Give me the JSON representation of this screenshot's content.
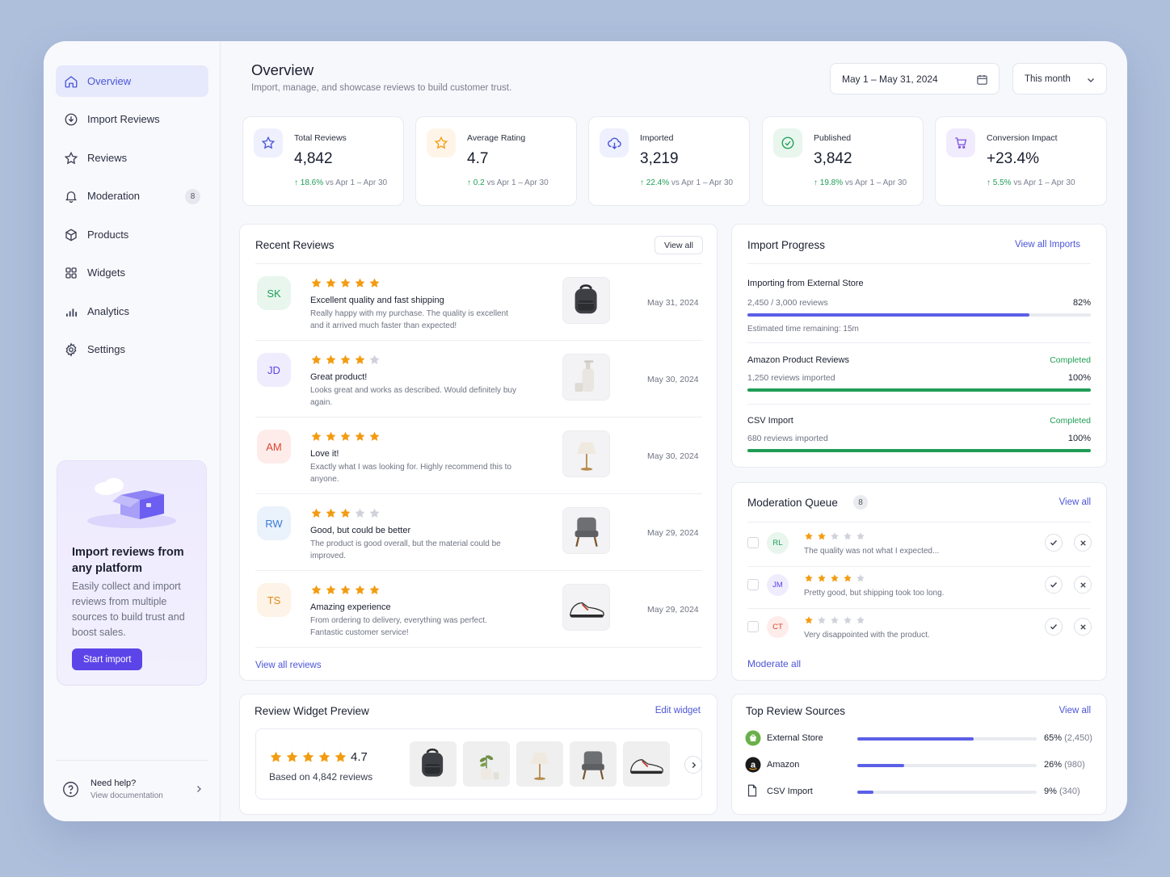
{
  "sidebar": {
    "items": [
      {
        "label": "Overview",
        "icon": "home-icon"
      },
      {
        "label": "Import Reviews",
        "icon": "import-icon"
      },
      {
        "label": "Reviews",
        "icon": "star-icon"
      },
      {
        "label": "Moderation",
        "icon": "bell-icon",
        "badge": "8"
      },
      {
        "label": "Products",
        "icon": "box-icon"
      },
      {
        "label": "Widgets",
        "icon": "grid-icon"
      },
      {
        "label": "Analytics",
        "icon": "chart-icon"
      },
      {
        "label": "Settings",
        "icon": "gear-icon"
      }
    ],
    "promo": {
      "title": "Import reviews from any platform",
      "text": "Easily collect and import reviews from multiple sources to build trust and boost sales.",
      "button": "Start import"
    },
    "help": {
      "title": "Need help?",
      "subtitle": "View documentation"
    }
  },
  "header": {
    "title": "Overview",
    "subtitle": "Import, manage, and showcase reviews to build customer trust.",
    "date_range": "May 1 – May 31, 2024",
    "period": "This month"
  },
  "stats": [
    {
      "label": "Total Reviews",
      "value": "4,842",
      "change": "18.6%",
      "compare": "vs Apr 1 – Apr 30",
      "icon": "star-icon",
      "accent": "#4b55d8",
      "bg": "#eef0fd"
    },
    {
      "label": "Average Rating",
      "value": "4.7",
      "change": "0.2",
      "compare": "vs Apr 1 – Apr 30",
      "icon": "star-icon",
      "accent": "#f39c12",
      "bg": "#fef5e8"
    },
    {
      "label": "Imported",
      "value": "3,219",
      "change": "22.4%",
      "compare": "vs Apr 1 – Apr 30",
      "icon": "cloud-download-icon",
      "accent": "#4b55d8",
      "bg": "#eef0fd"
    },
    {
      "label": "Published",
      "value": "3,842",
      "change": "19.8%",
      "compare": "vs Apr 1 – Apr 30",
      "icon": "check-circle-icon",
      "accent": "#1f9d55",
      "bg": "#e8f6ee"
    },
    {
      "label": "Conversion Impact",
      "value": "+23.4%",
      "change": "5.5%",
      "compare": "vs Apr 1 – Apr 30",
      "icon": "cart-icon",
      "accent": "#7b4fe0",
      "bg": "#f1ecfd"
    }
  ],
  "recent_reviews": {
    "title": "Recent Reviews",
    "view_all": "View all",
    "footer_link": "View all reviews",
    "items": [
      {
        "initials": "SK",
        "rating": 5,
        "title": "Excellent quality and fast shipping",
        "text": "Really happy with my purchase. The quality is excellent and it arrived much faster than expected!",
        "date": "May 31, 2024",
        "product": "backpack",
        "color": "#1f9d55",
        "bg": "#e8f6ee"
      },
      {
        "initials": "JD",
        "rating": 4,
        "title": "Great product!",
        "text": "Looks great and works as described. Would definitely buy again.",
        "date": "May 30, 2024",
        "product": "bottle",
        "color": "#5b45e8",
        "bg": "#efecfd"
      },
      {
        "initials": "AM",
        "rating": 5,
        "title": "Love it!",
        "text": "Exactly what I was looking for. Highly recommend this to anyone.",
        "date": "May 30, 2024",
        "product": "lamp",
        "color": "#d9462f",
        "bg": "#fdecea"
      },
      {
        "initials": "RW",
        "rating": 3,
        "title": "Good, but could be better",
        "text": "The product is good overall, but the material could be improved.",
        "date": "May 29, 2024",
        "product": "chair",
        "color": "#3a7bd5",
        "bg": "#eaf2fc"
      },
      {
        "initials": "TS",
        "rating": 5,
        "title": "Amazing experience",
        "text": "From ordering to delivery, everything was perfect. Fantastic customer service!",
        "date": "May 29, 2024",
        "product": "sneaker",
        "color": "#e08a1e",
        "bg": "#fdf3e6"
      }
    ]
  },
  "import_progress": {
    "title": "Import Progress",
    "view_all": "View all Imports",
    "items": [
      {
        "name": "Importing from External Store",
        "detail": "2,450 / 3,000 reviews",
        "percent_label": "82%",
        "fraction": 0.82,
        "extra": "Estimated time remaining: 15m",
        "status": "",
        "color": "#5b5fe6"
      },
      {
        "name": "Amazon Product Reviews",
        "detail": "1,250 reviews imported",
        "percent_label": "100%",
        "fraction": 1.0,
        "extra": "",
        "status": "Completed",
        "color": "#1f9d55"
      },
      {
        "name": "CSV Import",
        "detail": "680 reviews imported",
        "percent_label": "100%",
        "fraction": 1.0,
        "extra": "",
        "status": "Completed",
        "color": "#1f9d55"
      }
    ]
  },
  "moderation": {
    "title": "Moderation Queue",
    "count": "8",
    "view_all": "View all",
    "footer_link": "Moderate all",
    "items": [
      {
        "initials": "RL",
        "rating": 2,
        "text": "The quality was not what I expected...",
        "color": "#1f9d55",
        "bg": "#e8f6ee"
      },
      {
        "initials": "JM",
        "rating": 4,
        "text": "Pretty good, but shipping took too long.",
        "color": "#5b45e8",
        "bg": "#efecfd"
      },
      {
        "initials": "CT",
        "rating": 1,
        "text": "Very disappointed with the product.",
        "color": "#d9462f",
        "bg": "#fdecea"
      }
    ]
  },
  "widget_preview": {
    "title": "Review Widget Preview",
    "edit": "Edit widget",
    "rating": "4.7",
    "rating_value": 5,
    "based_on": "Based on 4,842 reviews",
    "thumbs": [
      "backpack",
      "plant",
      "lamp",
      "chair",
      "sneaker"
    ]
  },
  "top_sources": {
    "title": "Top Review Sources",
    "view_all": "View all",
    "items": [
      {
        "name": "External Store",
        "percent": "65%",
        "count": "(2,450)",
        "fraction": 0.65,
        "icon": "store-icon"
      },
      {
        "name": "Amazon",
        "percent": "26%",
        "count": "(980)",
        "fraction": 0.26,
        "icon": "amazon-icon"
      },
      {
        "name": "CSV Import",
        "percent": "9%",
        "count": "(340)",
        "fraction": 0.09,
        "icon": "file-icon"
      }
    ]
  },
  "colors": {
    "accent": "#5b45e8",
    "link": "#4b55d8",
    "star": "#f39c12",
    "success": "#1f9d55"
  }
}
